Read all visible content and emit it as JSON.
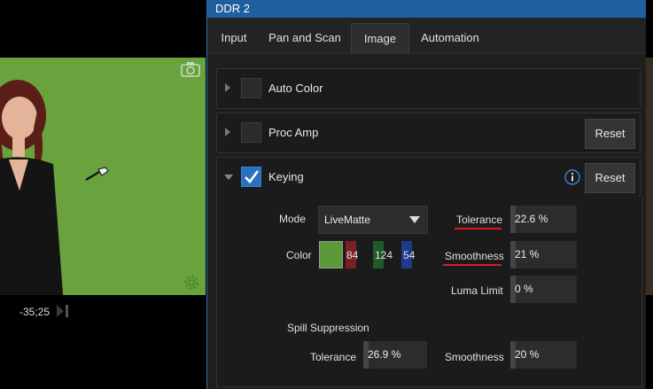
{
  "preview": {
    "timecode": "-35;25",
    "video_bg": "#6aa33d"
  },
  "window": {
    "title": "DDR 2"
  },
  "tabs": [
    {
      "label": "Input"
    },
    {
      "label": "Pan and Scan"
    },
    {
      "label": "Image",
      "active": true
    },
    {
      "label": "Automation"
    }
  ],
  "sections": {
    "auto_color": {
      "label": "Auto Color",
      "checked": false
    },
    "proc_amp": {
      "label": "Proc Amp",
      "checked": false,
      "reset": "Reset"
    },
    "keying": {
      "label": "Keying",
      "checked": true,
      "reset": "Reset"
    }
  },
  "keying": {
    "mode_label": "Mode",
    "mode_value": "LiveMatte",
    "color_label": "Color",
    "color_swatch": "#5a9a3a",
    "color_r": "84",
    "color_g": "124",
    "color_b": "54",
    "tolerance_label": "Tolerance",
    "tolerance_value": "22.6 %",
    "smoothness_label": "Smoothness",
    "smoothness_value": "21 %",
    "luma_limit_label": "Luma Limit",
    "luma_limit_value": "0 %",
    "spill_label": "Spill Suppression",
    "spill_tolerance_label": "Tolerance",
    "spill_tolerance_value": "26.9 %",
    "spill_smoothness_label": "Smoothness",
    "spill_smoothness_value": "20 %"
  },
  "colors": {
    "accent": "#1f5f9e",
    "checkbox_on": "#2a6fc0",
    "annotation_red": "#e0181c",
    "channel_red": "#7a1f24",
    "channel_green": "#1f5a2a",
    "channel_blue": "#1f3a8a"
  },
  "icons": [
    "camera-icon",
    "settings-icon",
    "eyedropper-icon",
    "step-forward-icon",
    "chevron-right-icon",
    "chevron-down-icon",
    "checkmark-icon",
    "info-icon",
    "dropdown-arrow-icon"
  ]
}
